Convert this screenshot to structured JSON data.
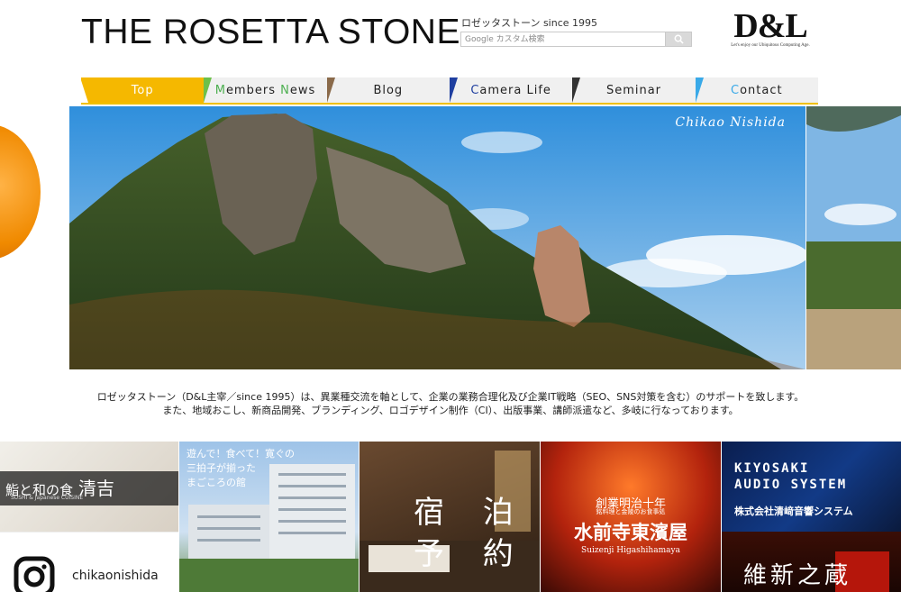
{
  "header": {
    "site_title": "THE ROSETTA STONE",
    "tagline": "ロゼッタストーン since 1995",
    "search_placeholder": "Google カスタム検索",
    "logo": {
      "mark": "D&L",
      "subtitle": "Let's enjoy our Ubiquitous Computing Age."
    }
  },
  "nav": {
    "items": [
      {
        "label": "Top",
        "active": true,
        "flag_color": "#f5b800"
      },
      {
        "label": "Members News",
        "active": false,
        "flag_color": "#6cc04a"
      },
      {
        "label": "Blog",
        "active": false,
        "flag_color": "#8a6a4a"
      },
      {
        "label": "Camera Life",
        "active": false,
        "flag_color": "#1f3fa0"
      },
      {
        "label": "Seminar",
        "active": false,
        "flag_color": "#333333"
      },
      {
        "label": "Contact",
        "active": false,
        "flag_color": "#39a9e8"
      }
    ]
  },
  "hero": {
    "signature": "Chikao Nishida"
  },
  "intro": {
    "line1": "ロゼッタストーン（D&L主宰／since 1995）は、異業種交流を軸として、企業の業務合理化及び企業IT戦略（SEO、SNS対策を含む）のサポートを致します。",
    "line2": "また、地域おこし、新商品開発、ブランディング、ロゴデザイン制作（CI）、出版事業、講師派遣など、多岐に行なっております。"
  },
  "tiles": {
    "sushi": {
      "title": "鮨と和の食",
      "name": "清吉",
      "subtitle": "SUSHI & Japanese CUISINE"
    },
    "instagram": {
      "handle": "chikaonishida"
    },
    "hotel": {
      "line1": "遊んで！食べて！寛ぐの",
      "line2": "三拍子が揃った",
      "line3": "まごころの館"
    },
    "booking": {
      "line1": "宿 泊",
      "line2": "予 約"
    },
    "higashihamaya": {
      "line1": "創業明治十年",
      "line2": "銘料理と金陵のお食事処",
      "line3": "水前寺東濱屋",
      "line4": "Suizenji Higashihamaya"
    },
    "kiyosaki": {
      "line1": "KIYOSAKI",
      "line2": "AUDIO SYSTEM",
      "line3": "株式会社清﨑音響システム"
    },
    "ishin": {
      "text": "維新之蔵"
    }
  },
  "colors": {
    "accent": "#f5b800",
    "nav_bg": "#f0f0f0"
  }
}
